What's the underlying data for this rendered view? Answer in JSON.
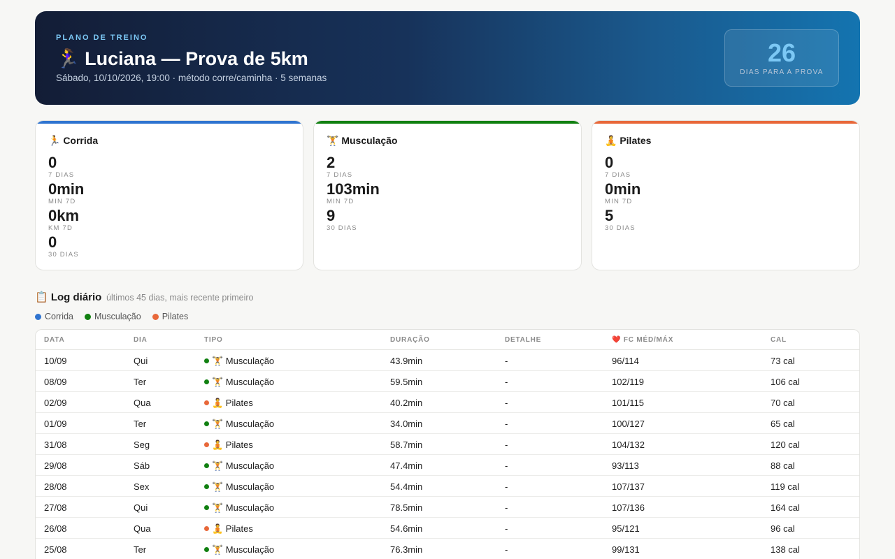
{
  "header": {
    "eyebrow": "PLANO DE TREINO",
    "title": "🏃‍♀️ Luciana — Prova de 5km",
    "subtitle": "Sábado, 10/10/2026, 19:00 · método corre/caminha · 5 semanas",
    "countdown_value": "26",
    "countdown_label": "DIAS PARA A PROVA"
  },
  "colors": {
    "corrida": "#2f74d0",
    "musculacao": "#118011",
    "pilates": "#e8683a"
  },
  "cards": [
    {
      "title": "🏃 Corrida",
      "stats": [
        {
          "value": "0",
          "label": "7 DIAS"
        },
        {
          "value": "0min",
          "label": "MIN 7D"
        },
        {
          "value": "0km",
          "label": "KM 7D"
        },
        {
          "value": "0",
          "label": "30 DIAS"
        }
      ]
    },
    {
      "title": "🏋️ Musculação",
      "stats": [
        {
          "value": "2",
          "label": "7 DIAS"
        },
        {
          "value": "103min",
          "label": "MIN 7D"
        },
        {
          "value": "9",
          "label": "30 DIAS"
        }
      ]
    },
    {
      "title": "🧘 Pilates",
      "stats": [
        {
          "value": "0",
          "label": "7 DIAS"
        },
        {
          "value": "0min",
          "label": "MIN 7D"
        },
        {
          "value": "5",
          "label": "30 DIAS"
        }
      ]
    }
  ],
  "log": {
    "title": "📋 Log diário",
    "subtitle": "últimos 45 dias, mais recente primeiro",
    "legend": [
      "Corrida",
      "Musculação",
      "Pilates"
    ],
    "columns": [
      "DATA",
      "DIA",
      "TIPO",
      "DURAÇÃO",
      "DETALHE",
      "❤️ FC MÉD/MÁX",
      "CAL"
    ],
    "rows": [
      {
        "data": "10/09",
        "dia": "Qui",
        "tipo": "🏋️ Musculação",
        "kind": "musculacao",
        "duracao": "43.9min",
        "detalhe": "-",
        "fc": "96/114",
        "cal": "73 cal"
      },
      {
        "data": "08/09",
        "dia": "Ter",
        "tipo": "🏋️ Musculação",
        "kind": "musculacao",
        "duracao": "59.5min",
        "detalhe": "-",
        "fc": "102/119",
        "cal": "106 cal"
      },
      {
        "data": "02/09",
        "dia": "Qua",
        "tipo": "🧘 Pilates",
        "kind": "pilates",
        "duracao": "40.2min",
        "detalhe": "-",
        "fc": "101/115",
        "cal": "70 cal"
      },
      {
        "data": "01/09",
        "dia": "Ter",
        "tipo": "🏋️ Musculação",
        "kind": "musculacao",
        "duracao": "34.0min",
        "detalhe": "-",
        "fc": "100/127",
        "cal": "65 cal"
      },
      {
        "data": "31/08",
        "dia": "Seg",
        "tipo": "🧘 Pilates",
        "kind": "pilates",
        "duracao": "58.7min",
        "detalhe": "-",
        "fc": "104/132",
        "cal": "120 cal"
      },
      {
        "data": "29/08",
        "dia": "Sáb",
        "tipo": "🏋️ Musculação",
        "kind": "musculacao",
        "duracao": "47.4min",
        "detalhe": "-",
        "fc": "93/113",
        "cal": "88 cal"
      },
      {
        "data": "28/08",
        "dia": "Sex",
        "tipo": "🏋️ Musculação",
        "kind": "musculacao",
        "duracao": "54.4min",
        "detalhe": "-",
        "fc": "107/137",
        "cal": "119 cal"
      },
      {
        "data": "27/08",
        "dia": "Qui",
        "tipo": "🏋️ Musculação",
        "kind": "musculacao",
        "duracao": "78.5min",
        "detalhe": "-",
        "fc": "107/136",
        "cal": "164 cal"
      },
      {
        "data": "26/08",
        "dia": "Qua",
        "tipo": "🧘 Pilates",
        "kind": "pilates",
        "duracao": "54.6min",
        "detalhe": "-",
        "fc": "95/121",
        "cal": "96 cal"
      },
      {
        "data": "25/08",
        "dia": "Ter",
        "tipo": "🏋️ Musculação",
        "kind": "musculacao",
        "duracao": "76.3min",
        "detalhe": "-",
        "fc": "99/131",
        "cal": "138 cal"
      }
    ]
  }
}
